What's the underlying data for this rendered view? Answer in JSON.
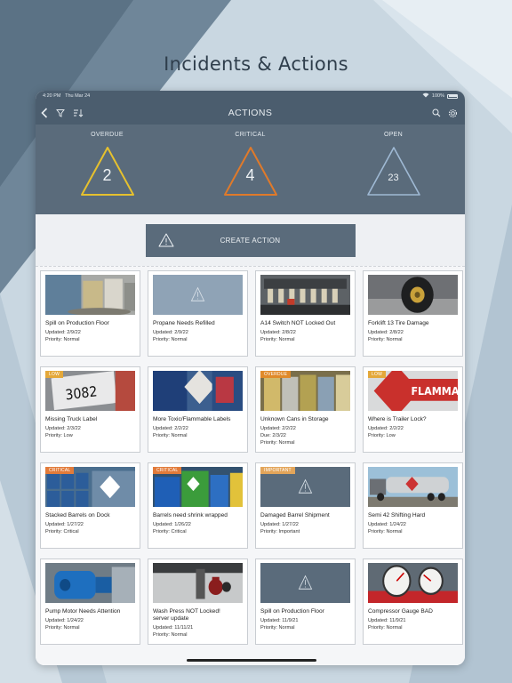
{
  "page_title": "Incidents & Actions",
  "colors": {
    "navbar": "#4b5d6e",
    "stats_bg": "#5a6b7b",
    "overdue": "#e6c12e",
    "critical": "#e07a2a",
    "open": "#9fb9d4",
    "badge_low": "#e4a83a",
    "badge_overdue": "#e08a2a",
    "badge_critical": "#e27b3a",
    "badge_important": "#e3a55a"
  },
  "status_bar": {
    "time": "4:20 PM",
    "date": "Thu Mar 24",
    "battery": "100%"
  },
  "navbar": {
    "title": "ACTIONS",
    "icons": [
      "back-chevron-icon",
      "filter-icon",
      "sort-icon",
      "search-icon",
      "gear-icon"
    ]
  },
  "stats": [
    {
      "label": "OVERDUE",
      "value": "2",
      "color": "#e6c12e"
    },
    {
      "label": "CRITICAL",
      "value": "4",
      "color": "#e07a2a"
    },
    {
      "label": "OPEN",
      "value": "23",
      "color": "#9fb9d4"
    }
  ],
  "create_action": {
    "label": "CREATE ACTION"
  },
  "cards": [
    {
      "title": "Spill on Production Floor",
      "updated": "Updated: 2/9/22",
      "priority": "Priority: Normal",
      "badge": "",
      "thumb": "photo-spill"
    },
    {
      "title": "Propane Needs Refilled",
      "updated": "Updated: 2/9/22",
      "priority": "Priority: Normal",
      "badge": "",
      "thumb": "placeholder-light"
    },
    {
      "title": "A14 Switch NOT Locked Out",
      "updated": "Updated: 2/8/22",
      "priority": "Priority: Normal",
      "badge": "",
      "thumb": "photo-switch"
    },
    {
      "title": "Forklift 13 Tire Damage",
      "updated": "Updated: 2/8/22",
      "priority": "Priority: Normal",
      "badge": "",
      "thumb": "photo-tire"
    },
    {
      "title": "Missing Truck Label",
      "updated": "Updated: 2/3/22",
      "priority": "Priority: Low",
      "badge": "LOW",
      "thumb": "photo-label"
    },
    {
      "title": "More Toxic/Flammable Labels",
      "updated": "Updated: 2/2/22",
      "priority": "Priority: Normal",
      "badge": "",
      "thumb": "photo-barrel-blue"
    },
    {
      "title": "Unknown Cans in Storage",
      "updated": "Updated: 2/2/22",
      "due": "Due: 2/3/22",
      "priority": "Priority: Normal",
      "badge": "OVERDUE",
      "thumb": "photo-cans"
    },
    {
      "title": "Where is Trailer Lock?",
      "updated": "Updated: 2/2/22",
      "priority": "Priority: Low",
      "badge": "LOW",
      "thumb": "photo-flammable"
    },
    {
      "title": "Stacked Barrels on Dock",
      "updated": "Updated: 1/27/22",
      "priority": "Priority: Critical",
      "badge": "CRITICAL",
      "thumb": "photo-barrels-stack"
    },
    {
      "title": "Barrels need shrink wrapped",
      "updated": "Updated: 1/26/22",
      "priority": "Priority: Critical",
      "badge": "CRITICAL",
      "thumb": "photo-barrels-color"
    },
    {
      "title": "Damaged Barrel Shipment",
      "updated": "Updated: 1/27/22",
      "priority": "Priority: Important",
      "badge": "IMPORTANT",
      "thumb": "placeholder-dark"
    },
    {
      "title": "Semi 42 Shifting Hard",
      "updated": "Updated: 1/24/22",
      "priority": "Priority: Normal",
      "badge": "",
      "thumb": "photo-semi"
    },
    {
      "title": "Pump Motor Needs Attention",
      "updated": "Updated: 1/24/22",
      "priority": "Priority: Normal",
      "badge": "",
      "thumb": "photo-motor"
    },
    {
      "title": "Wash Press NOT Locked!",
      "title2": "server update",
      "updated": "Updated: 11/11/21",
      "priority": "Priority: Normal",
      "badge": "",
      "thumb": "photo-lock"
    },
    {
      "title": "Spill on Production Floor",
      "updated": "Updated: 11/9/21",
      "priority": "Priority: Normal",
      "badge": "",
      "thumb": "placeholder-dark"
    },
    {
      "title": "Compressor Gauge BAD",
      "updated": "Updated: 11/9/21",
      "priority": "Priority: Normal",
      "badge": "",
      "thumb": "photo-gauge"
    }
  ]
}
